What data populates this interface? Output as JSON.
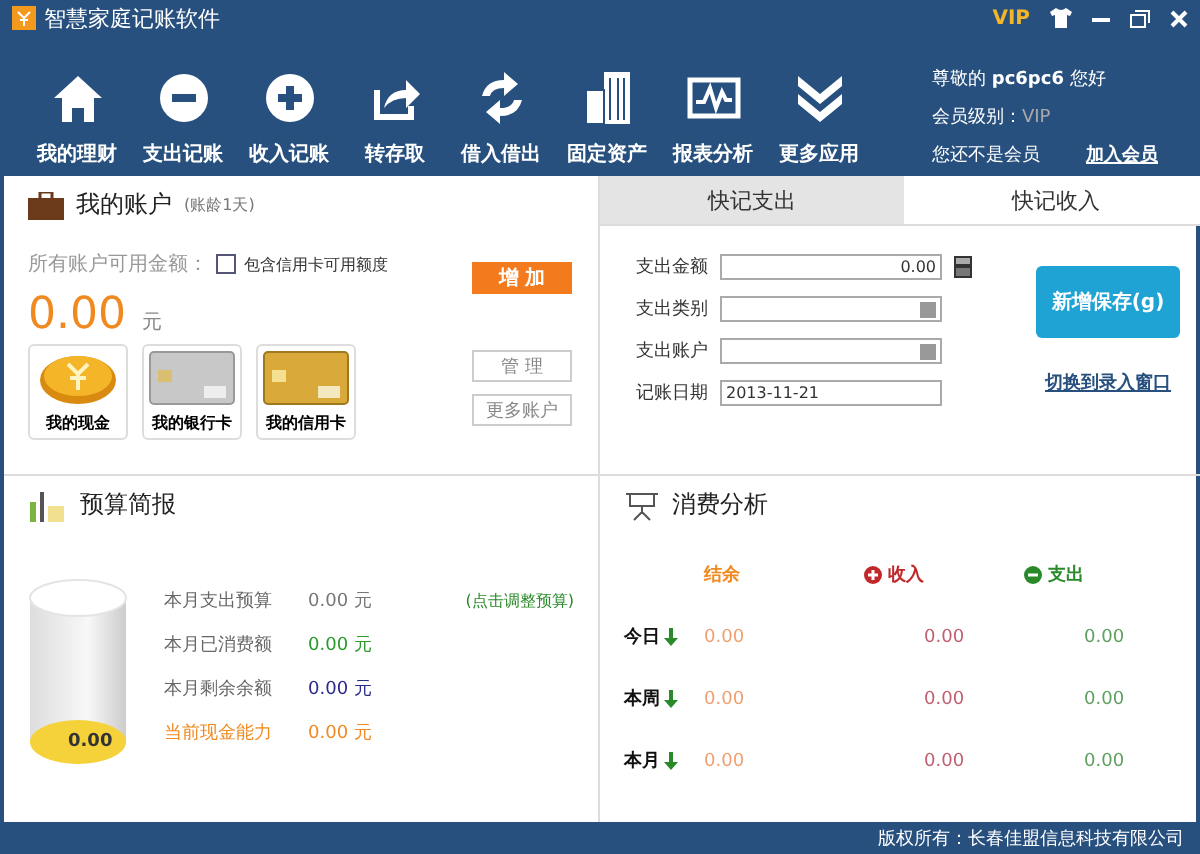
{
  "window": {
    "title": "智慧家庭记账软件",
    "vip": "VIP"
  },
  "toolbar": [
    {
      "label": "我的理财",
      "kind": "home"
    },
    {
      "label": "支出记账",
      "kind": "minus"
    },
    {
      "label": "收入记账",
      "kind": "plus"
    },
    {
      "label": "转存取",
      "kind": "share"
    },
    {
      "label": "借入借出",
      "kind": "cycle"
    },
    {
      "label": "固定资产",
      "kind": "building"
    },
    {
      "label": "报表分析",
      "kind": "chart"
    },
    {
      "label": "更多应用",
      "kind": "chevrons"
    }
  ],
  "user": {
    "greeting": "尊敬的",
    "name": "pc6pc6",
    "hello": "您好",
    "level_label": "会员级别：",
    "level": "VIP",
    "not_member": "您还不是会员",
    "join": "加入会员"
  },
  "accounts": {
    "title": "我的账户",
    "age": "(账龄1天)",
    "available_label": "所有账户可用金额：",
    "include_credit": {
      "label": "包含信用卡可用额度",
      "checked": false
    },
    "amount": "0.00",
    "unit": "元",
    "add": "增 加",
    "manage": "管 理",
    "more": "更多账户",
    "cards": [
      {
        "label": "我的现金",
        "kind": "coin"
      },
      {
        "label": "我的银行卡",
        "kind": "silver"
      },
      {
        "label": "我的信用卡",
        "kind": "gold"
      }
    ]
  },
  "quick": {
    "tabs": [
      {
        "label": "快记支出",
        "selected": true
      },
      {
        "label": "快记收入",
        "selected": false
      }
    ],
    "fields": [
      {
        "label": "支出金额",
        "kind": "calc",
        "value": "0.00"
      },
      {
        "label": "支出类别",
        "kind": "select"
      },
      {
        "label": "支出账户",
        "kind": "select"
      },
      {
        "label": "记账日期",
        "kind": "text",
        "value": "2013-11-21"
      }
    ],
    "save": "新增保存(g)",
    "switch": "切换到录入窗口"
  },
  "budget": {
    "title": "预算简报",
    "cylinder_value": "0.00",
    "adjust": "(点击调整预算)",
    "rows": [
      {
        "label": "本月支出预算",
        "value": "0.00",
        "unit": "元",
        "color": "#777777"
      },
      {
        "label": "本月已消费额",
        "value": "0.00",
        "unit": "元",
        "color": "#2a9a2a"
      },
      {
        "label": "本月剩余余额",
        "value": "0.00",
        "unit": "元",
        "color": "#2a2a8a"
      },
      {
        "label": "当前现金能力",
        "value": "0.00",
        "unit": "元",
        "color": "#f08a20"
      }
    ]
  },
  "analysis": {
    "title": "消费分析",
    "columns": [
      {
        "label": "结余",
        "kind": "plain"
      },
      {
        "label": "收入",
        "kind": "plus"
      },
      {
        "label": "支出",
        "kind": "minus"
      }
    ],
    "rows": [
      {
        "label": "今日",
        "values": [
          "0.00",
          "0.00",
          "0.00"
        ]
      },
      {
        "label": "本周",
        "values": [
          "0.00",
          "0.00",
          "0.00"
        ]
      },
      {
        "label": "本月",
        "values": [
          "0.00",
          "0.00",
          "0.00"
        ]
      }
    ]
  },
  "status_bar": "版权所有：长春佳盟信息科技有限公司"
}
